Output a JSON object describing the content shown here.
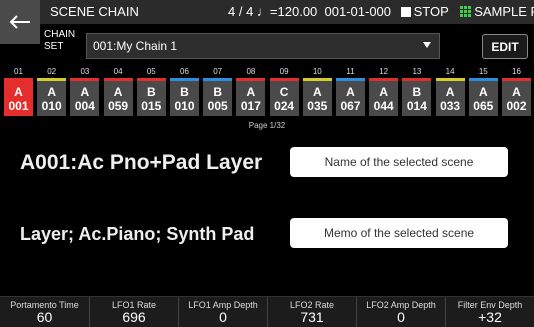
{
  "header": {
    "title": "SCENE CHAIN",
    "beat": "4 / 4",
    "tempo": "♩=120.00",
    "position": "001-01-000",
    "transport": "STOP",
    "pad_label": "SAMPLE PAD",
    "back_icon": "back-arrow-icon"
  },
  "chain": {
    "label": "CHAIN SET",
    "selected": "001:My Chain 1",
    "edit_label": "EDIT"
  },
  "steps": [
    {
      "num": "01",
      "bank": "A",
      "scene": "001",
      "color": "#e42d2d"
    },
    {
      "num": "02",
      "bank": "A",
      "scene": "010",
      "color": "#d8cc2a"
    },
    {
      "num": "03",
      "bank": "A",
      "scene": "004",
      "color": "#e42d2d"
    },
    {
      "num": "04",
      "bank": "A",
      "scene": "059",
      "color": "#e42d2d"
    },
    {
      "num": "05",
      "bank": "B",
      "scene": "015",
      "color": "#e42d2d"
    },
    {
      "num": "06",
      "bank": "B",
      "scene": "010",
      "color": "#2a8fe0"
    },
    {
      "num": "07",
      "bank": "B",
      "scene": "005",
      "color": "#2a8fe0"
    },
    {
      "num": "08",
      "bank": "A",
      "scene": "017",
      "color": "#e42d2d"
    },
    {
      "num": "09",
      "bank": "C",
      "scene": "024",
      "color": "#e42d2d"
    },
    {
      "num": "10",
      "bank": "A",
      "scene": "035",
      "color": "#d8cc2a"
    },
    {
      "num": "11",
      "bank": "A",
      "scene": "067",
      "color": "#2a8fe0"
    },
    {
      "num": "12",
      "bank": "A",
      "scene": "044",
      "color": "#e42d2d"
    },
    {
      "num": "13",
      "bank": "B",
      "scene": "014",
      "color": "#e42d2d"
    },
    {
      "num": "14",
      "bank": "A",
      "scene": "033",
      "color": "#d8cc2a"
    },
    {
      "num": "15",
      "bank": "A",
      "scene": "065",
      "color": "#2a8fe0"
    },
    {
      "num": "16",
      "bank": "A",
      "scene": "002",
      "color": "#e42d2d"
    }
  ],
  "selected_step": 0,
  "page_indicator": "Page  1/32",
  "scene": {
    "name": "A001:Ac Pno+Pad Layer",
    "memo": "Layer;  Ac.Piano;  Synth Pad",
    "name_hint": "Name of the selected scene",
    "memo_hint": "Memo of the selected scene"
  },
  "params": [
    {
      "label": "Portamento Time",
      "value": "60"
    },
    {
      "label": "LFO1 Rate",
      "value": "696"
    },
    {
      "label": "LFO1 Amp Depth",
      "value": "0"
    },
    {
      "label": "LFO2 Rate",
      "value": "731"
    },
    {
      "label": "LFO2 Amp Depth",
      "value": "0"
    },
    {
      "label": "Filter Env Depth",
      "value": "+32"
    }
  ],
  "colors": {
    "selected": "#e42d2d",
    "cell": "#4a4a4a",
    "pad_icon": "#3bd24a"
  }
}
